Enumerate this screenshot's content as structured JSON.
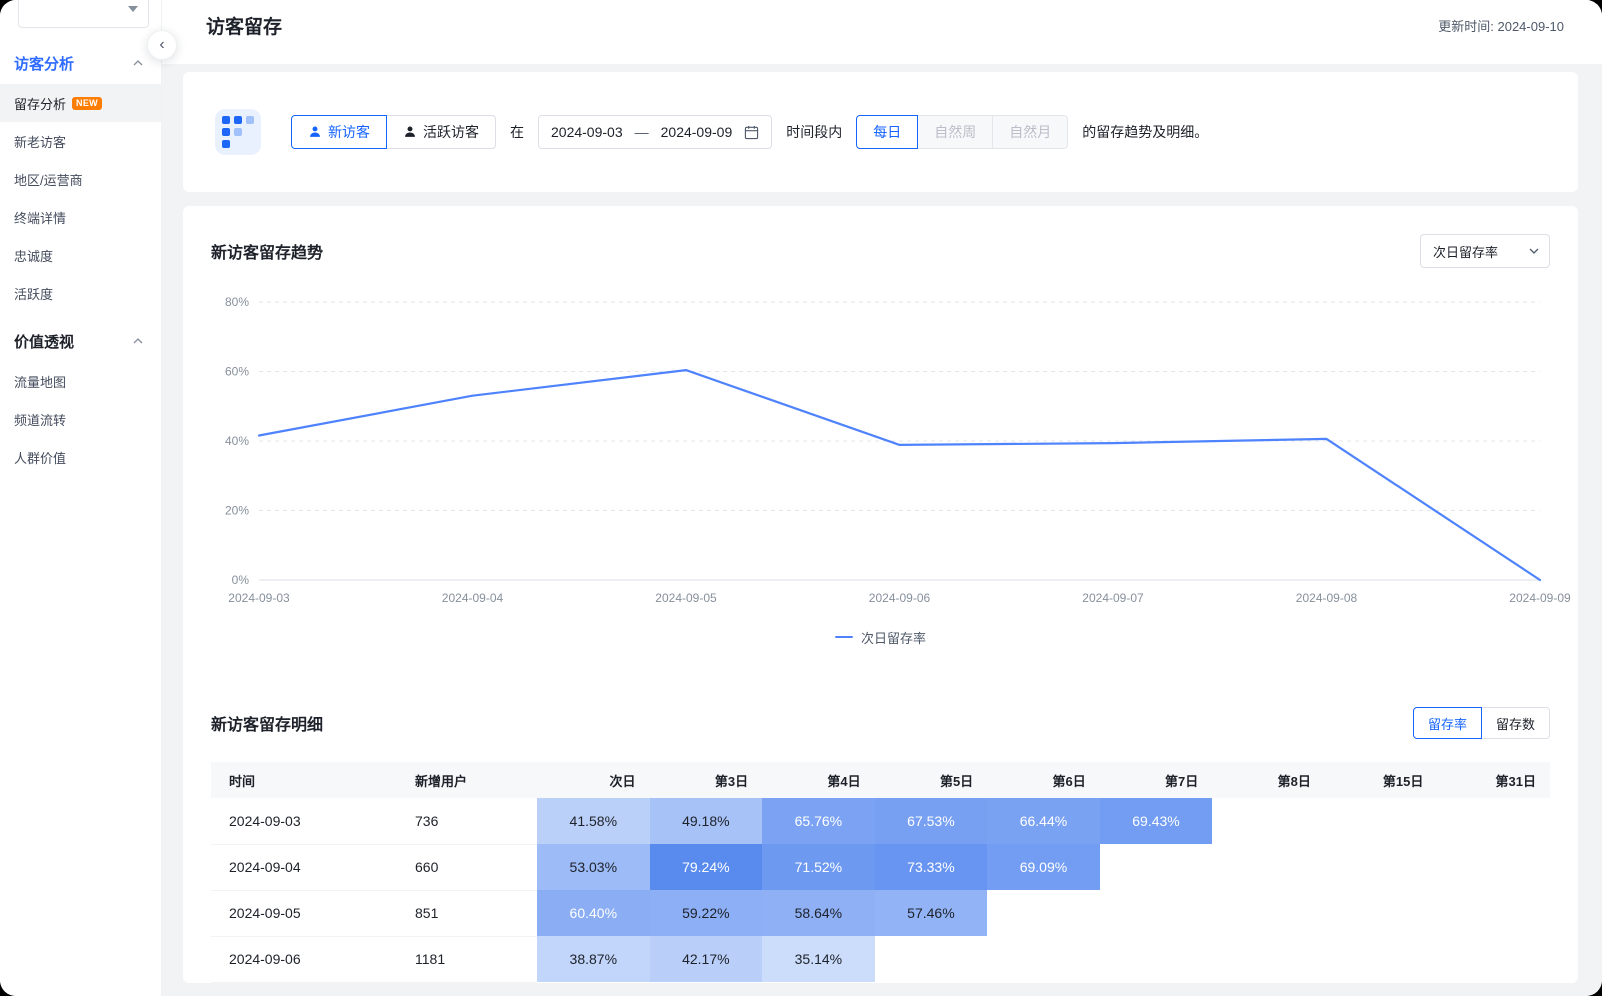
{
  "window": {
    "update_time": "更新时间: 2024-09-10"
  },
  "header": {
    "title": "访客留存"
  },
  "sidebar": {
    "sections": [
      {
        "label": "访客分析",
        "items": [
          {
            "label": "留存分析",
            "badge": "NEW"
          },
          {
            "label": "新老访客"
          },
          {
            "label": "地区/运营商"
          },
          {
            "label": "终端详情"
          },
          {
            "label": "忠诚度"
          },
          {
            "label": "活跃度"
          }
        ]
      },
      {
        "label": "价值透视",
        "items": [
          {
            "label": "流量地图"
          },
          {
            "label": "频道流转"
          },
          {
            "label": "人群价值"
          }
        ]
      }
    ]
  },
  "filters": {
    "visitor_type": [
      {
        "label": "新访客"
      },
      {
        "label": "活跃访客"
      }
    ],
    "in_label": "在",
    "date_start": "2024-09-03",
    "date_separator": "—",
    "date_end": "2024-09-09",
    "period_suffix": "时间段内",
    "granularity": [
      {
        "label": "每日"
      },
      {
        "label": "自然周"
      },
      {
        "label": "自然月"
      }
    ],
    "description_suffix": "的留存趋势及明细。"
  },
  "trend": {
    "title": "新访客留存趋势",
    "metric_select": "次日留存率",
    "legend": "次日留存率"
  },
  "chart_data": {
    "type": "line",
    "x": [
      "2024-09-03",
      "2024-09-04",
      "2024-09-05",
      "2024-09-06",
      "2024-09-07",
      "2024-09-08",
      "2024-09-09"
    ],
    "series": [
      {
        "name": "次日留存率",
        "values": [
          41.58,
          53.03,
          60.4,
          38.87,
          39.4,
          40.6,
          0
        ]
      }
    ],
    "ylim": [
      0,
      80
    ],
    "yticks": [
      "0%",
      "20%",
      "40%",
      "60%",
      "80%"
    ],
    "grid": "dashed-horizontal",
    "legend_position": "bottom-center",
    "line_color": "#4e83fd"
  },
  "detail": {
    "title": "新访客留存明细",
    "mode_toggle": [
      {
        "label": "留存率"
      },
      {
        "label": "留存数"
      }
    ],
    "table": {
      "headers": [
        "时间",
        "新增用户",
        "次日",
        "第3日",
        "第4日",
        "第5日",
        "第6日",
        "第7日",
        "第8日",
        "第15日",
        "第31日"
      ],
      "rows": [
        {
          "date": "2024-09-03",
          "new_users": "736",
          "cells": [
            41.58,
            49.18,
            65.76,
            67.53,
            66.44,
            69.43,
            null,
            null,
            null
          ]
        },
        {
          "date": "2024-09-04",
          "new_users": "660",
          "cells": [
            53.03,
            79.24,
            71.52,
            73.33,
            69.09,
            null,
            null,
            null,
            null
          ]
        },
        {
          "date": "2024-09-05",
          "new_users": "851",
          "cells": [
            60.4,
            59.22,
            58.64,
            57.46,
            null,
            null,
            null,
            null,
            null
          ]
        },
        {
          "date": "2024-09-06",
          "new_users": "1181",
          "cells": [
            38.87,
            42.17,
            35.14,
            null,
            null,
            null,
            null,
            null,
            null
          ]
        }
      ]
    }
  },
  "colors": {
    "primary": "#1664ff",
    "line": "#4e83fd",
    "heat_light": "#d9e5fc",
    "heat_dark": "#4a80ee",
    "badge_orange": "#ff7d00"
  }
}
